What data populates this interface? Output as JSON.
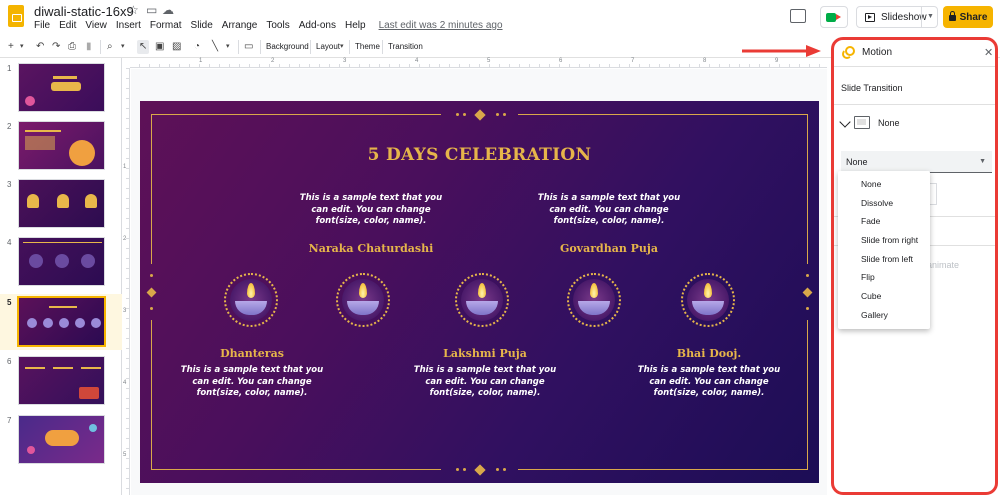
{
  "app": {
    "title": "diwali-static-16x9",
    "last_edit": "Last edit was 2 minutes ago",
    "menus": [
      "File",
      "Edit",
      "View",
      "Insert",
      "Format",
      "Slide",
      "Arrange",
      "Tools",
      "Add-ons",
      "Help"
    ],
    "slideshow_label": "Slideshow",
    "share_label": "Share"
  },
  "toolbar": {
    "background": "Background",
    "layout": "Layout",
    "theme": "Theme",
    "transition": "Transition"
  },
  "filmstrip": {
    "slides": [
      "1",
      "2",
      "3",
      "4",
      "5",
      "6",
      "7"
    ],
    "active_index": 5
  },
  "ruler": {
    "h_numbers": [
      "1",
      "2",
      "3",
      "4",
      "5",
      "6",
      "7",
      "8",
      "9"
    ],
    "v_numbers": [
      "1",
      "2",
      "3",
      "4",
      "5"
    ]
  },
  "slide": {
    "title": "5 DAYS CELEBRATION",
    "days": [
      {
        "name": "Dhanteras",
        "text": "This is a sample text that you can edit. You can change font(size, color, name)."
      },
      {
        "name": "Naraka Chaturdashi",
        "text": "This is a sample text that you can edit. You can change font(size, color, name)."
      },
      {
        "name": "Lakshmi Puja",
        "text": "This is a sample text that you can edit. You can change font(size, color, name)."
      },
      {
        "name": "Govardhan Puja",
        "text": "This is a sample text that you can edit. You can change font(size, color, name)."
      },
      {
        "name": "Bhai Dooj.",
        "text": "This is a sample text that you can edit. You can change font(size, color, name)."
      }
    ]
  },
  "motion_panel": {
    "title": "Motion",
    "subtitle": "Slide Transition",
    "current_transition": "None",
    "select_value": "None",
    "animate_hint": "animate",
    "options": [
      "None",
      "Dissolve",
      "Fade",
      "Slide from right",
      "Slide from left",
      "Flip",
      "Cube",
      "Gallery"
    ]
  },
  "colors": {
    "accent": "#f6b400",
    "annotation": "#ea3b35",
    "slide_gold": "#e6b54a"
  }
}
